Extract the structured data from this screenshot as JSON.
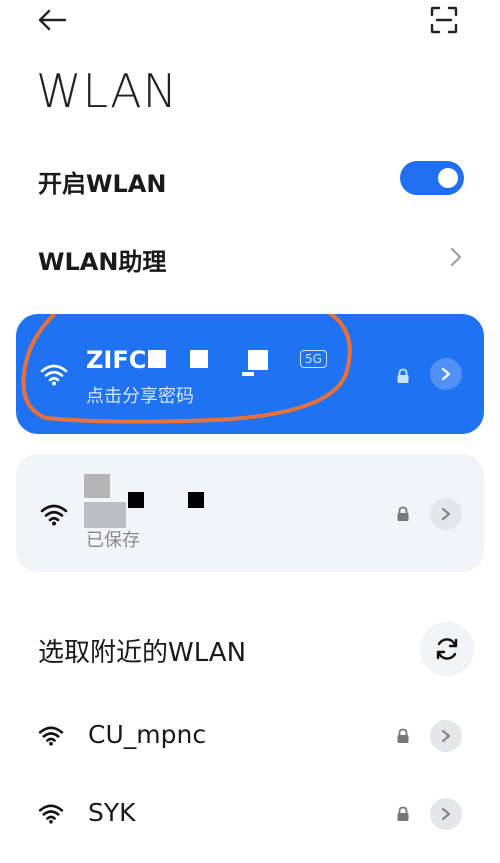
{
  "header": {
    "title": "WLAN",
    "back_icon": "arrow-left-icon",
    "scan_icon": "scan-qr-icon"
  },
  "settings": {
    "enable_wlan_label": "开启WLAN",
    "wlan_assistant_label": "WLAN助理",
    "toggle_on": true
  },
  "connected": {
    "ssid": "ZIFC",
    "band_badge": "5G",
    "subtitle": "点击分享密码"
  },
  "saved": {
    "subtitle": "已保存"
  },
  "nearby": {
    "section_title": "选取附近的WLAN",
    "networks": [
      {
        "ssid": "CU_mpnc"
      },
      {
        "ssid": "SYK"
      }
    ]
  },
  "colors": {
    "accent": "#1f72f2",
    "annotation": "#e8703a"
  }
}
